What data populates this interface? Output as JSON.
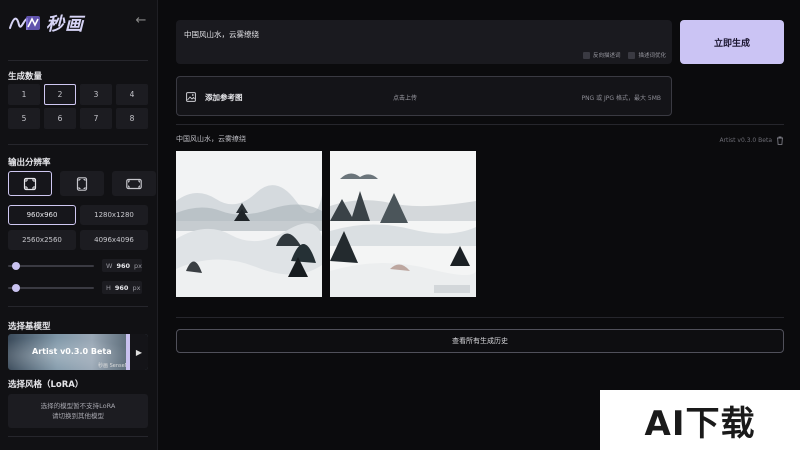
{
  "brand": {
    "name": "秒画"
  },
  "sidebar": {
    "count_label": "生成数量",
    "counts": [
      "1",
      "2",
      "3",
      "4",
      "5",
      "6",
      "7",
      "8"
    ],
    "count_selected": "2",
    "resolution_label": "输出分辨率",
    "aspect_ratios": [
      "square-icon",
      "portrait-icon",
      "landscape-icon"
    ],
    "resolutions": [
      "960x960",
      "1280x1280",
      "2560x2560",
      "4096x4096"
    ],
    "resolution_selected": "960x960",
    "width": {
      "label": "W",
      "value": "960",
      "unit": "px"
    },
    "height": {
      "label": "H",
      "value": "960",
      "unit": "px"
    },
    "model_label": "选择基模型",
    "model_name": "Artist v0.3.0 Beta",
    "model_tag": "秒画 SenseMirage",
    "lora_label": "选择风格（LoRA）",
    "lora_notice_line1": "选择的模型暂不支持LoRA",
    "lora_notice_line2": "请切换到其他模型"
  },
  "prompt": {
    "text": "中国风山水，云雾缭绕",
    "option_negative": "反向描述词",
    "option_optimize": "描述词优化"
  },
  "generate_button": "立即生成",
  "upload": {
    "title": "添加参考图",
    "click": "点击上传",
    "hint": "PNG 或 JPG 格式，最大 5MB"
  },
  "result": {
    "prompt": "中国风山水，云雾缭绕",
    "model": "Artist v0.3.0 Beta"
  },
  "history_button": "查看所有生成历史",
  "watermark": "AI下载",
  "colors": {
    "accent": "#cbc4f4",
    "background": "#0b0b0d",
    "panel": "#1a1a1f"
  }
}
